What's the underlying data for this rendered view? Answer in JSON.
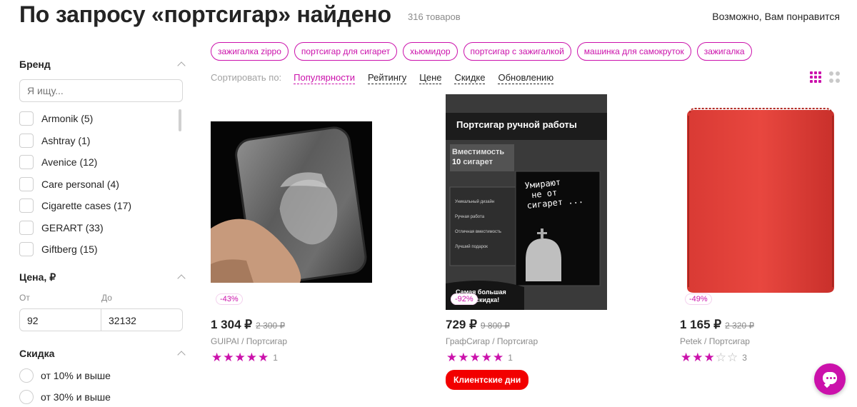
{
  "header": {
    "title": "По запросу «портсигар» найдено",
    "count": "316 товаров",
    "recommend_link": "Возможно, Вам понравится"
  },
  "filters": {
    "brand": {
      "title": "Бренд",
      "search_placeholder": "Я ищу...",
      "items": [
        "Armonik (5)",
        "Ashtray (1)",
        "Avenice (12)",
        "Care personal (4)",
        "Cigarette cases (17)",
        "GERART (33)",
        "Giftberg (15)"
      ]
    },
    "price": {
      "title": "Цена, ₽",
      "from_label": "От",
      "to_label": "До",
      "from_value": "92",
      "to_value": "32132"
    },
    "discount": {
      "title": "Скидка",
      "options": [
        "от 10% и выше",
        "от 30% и выше"
      ]
    }
  },
  "tags": [
    "зажигалка zippo",
    "портсигар для сигарет",
    "хьюмидор",
    "портсигар с зажигалкой",
    "машинка для самокруток",
    "зажигалка"
  ],
  "sort": {
    "label": "Сортировать по:",
    "options": [
      "Популярности",
      "Рейтингу",
      "Цене",
      "Скидке",
      "Обновлению"
    ],
    "active": "Популярности"
  },
  "products": [
    {
      "discount": "-43%",
      "price": "1 304 ₽",
      "old_price": "2 300 ₽",
      "seller": "GUIPAI / Портсигар",
      "rating": 5,
      "reviews": "1"
    },
    {
      "discount": "-92%",
      "price": "729 ₽",
      "old_price": "9 800 ₽",
      "seller": "ГрафСигар / Портсигар",
      "rating": 5,
      "reviews": "1",
      "promo": "Клиентские дни",
      "image_text": {
        "headline": "Портсигар ручной работы",
        "capacity_line1": "Вместимость",
        "capacity_num": "10",
        "capacity_line2": "сигарет",
        "features": [
          "Уникальный дизайн",
          "Ручная работа",
          "Отличная вместимость",
          "Лучший подарок"
        ],
        "case_text": [
          "Умирают",
          "не от",
          "сигарет ..."
        ],
        "bottom_line1": "Самая большая",
        "bottom_line2": "скидка!"
      }
    },
    {
      "discount": "-49%",
      "price": "1 165 ₽",
      "old_price": "2 320 ₽",
      "seller": "Petek / Портсигар",
      "rating": 3,
      "reviews": "3"
    }
  ],
  "colors": {
    "accent": "#cb11ab",
    "promo": "#f20000"
  }
}
